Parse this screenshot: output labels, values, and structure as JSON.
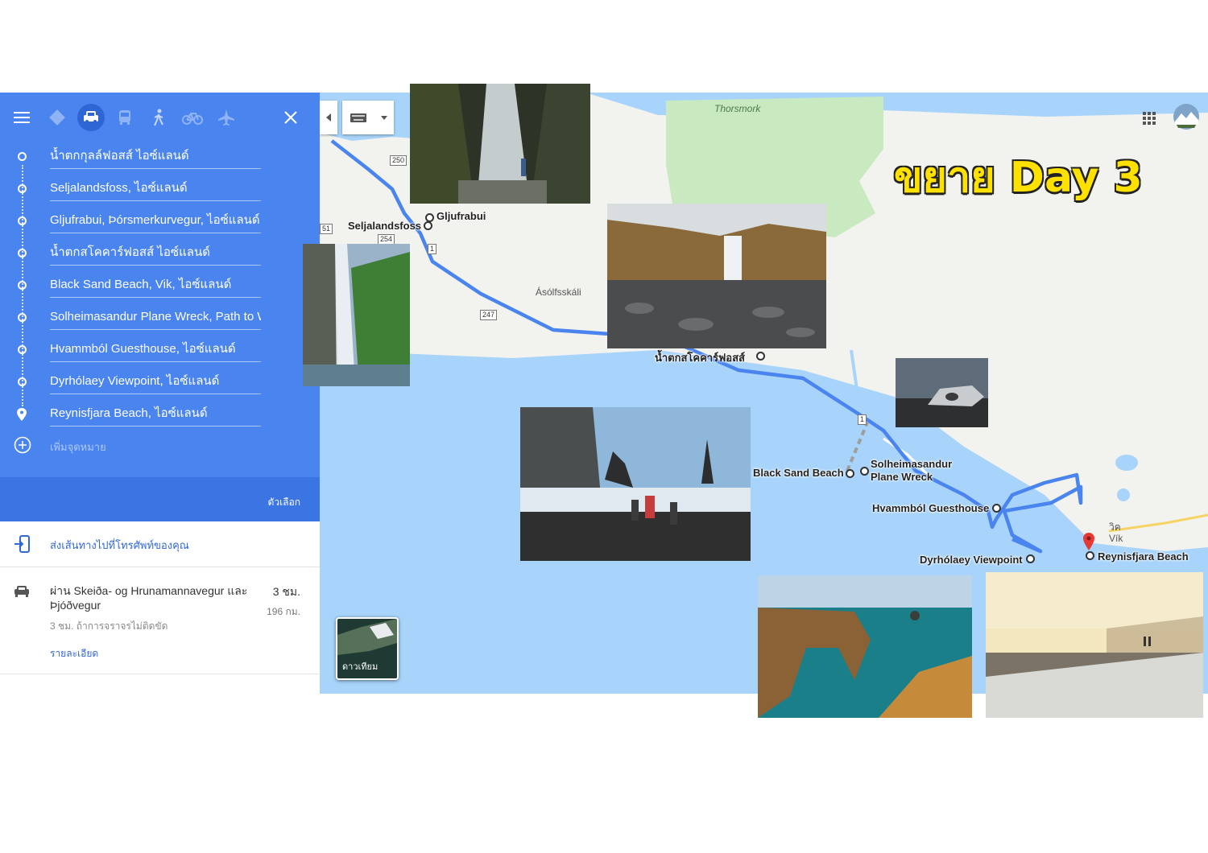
{
  "travel_modes": [
    {
      "name": "best-route-icon",
      "active": false
    },
    {
      "name": "car-icon",
      "active": true
    },
    {
      "name": "transit-icon",
      "active": false
    },
    {
      "name": "walk-icon",
      "active": false
    },
    {
      "name": "bicycle-icon",
      "active": false
    },
    {
      "name": "plane-icon",
      "active": false
    }
  ],
  "waypoints": [
    "น้ำตกกุลล์ฟอสส์ ไอซ์แลนด์",
    "Seljalandsfoss, ไอซ์แลนด์",
    "Gljufrabui, Þórsmerkurvegur, ไอซ์แลนด์",
    "น้ำตกสโคคาร์ฟอสส์ ไอซ์แลนด์",
    "Black Sand Beach, Vik, ไอซ์แลนด์",
    "Solheimasandur Plane Wreck, Path to W",
    "Hvammból Guesthouse, ไอซ์แลนด์",
    "Dyrhólaey Viewpoint, ไอซ์แลนด์",
    "Reynisfjara Beach, ไอซ์แลนด์"
  ],
  "add_destination": "เพิ่มจุดหมาย",
  "options_label": "ตัวเลือก",
  "send_to_phone": "ส่งเส้นทางไปที่โทรศัพท์ของคุณ",
  "route": {
    "via": "ผ่าน Skeiða- og Hrunamannavegur และ Þjóðvegur",
    "time": "3 ชม.",
    "distance": "196 กม.",
    "traffic": "3 ชม. ถ้าการจราจรไม่ติดขัด",
    "details": "รายละเอียด"
  },
  "map": {
    "headline": "ขยาย Day 3",
    "satellite_label": "ดาวเทียม",
    "places": {
      "thorsmork": "Thorsmork",
      "asolfsskali": "Ásólfsskáli",
      "seljalandsfoss": "Seljalandsfoss",
      "gljufrabui": "Gljufrabui",
      "skogafoss": "น้ำตกสโคคาร์ฟอสส์",
      "black_sand": "Black Sand Beach",
      "plane_wreck_1": "Solheimasandur",
      "plane_wreck_2": "Plane Wreck",
      "guesthouse": "Hvammból Guesthouse",
      "dyrholaey": "Dyrhólaey Viewpoint",
      "reynisfjara": "Reynisfjara Beach",
      "vik_th": "วิค",
      "vik": "Vík"
    },
    "roads": [
      "250",
      "254",
      "1",
      "247",
      "1",
      "51"
    ],
    "colors": {
      "route": "#4a84ee",
      "water": "#a8d4fb",
      "land": "#f2f2ee",
      "park": "#c9eac0",
      "accent": "#4a84ee",
      "headline": "#ffe100"
    }
  }
}
